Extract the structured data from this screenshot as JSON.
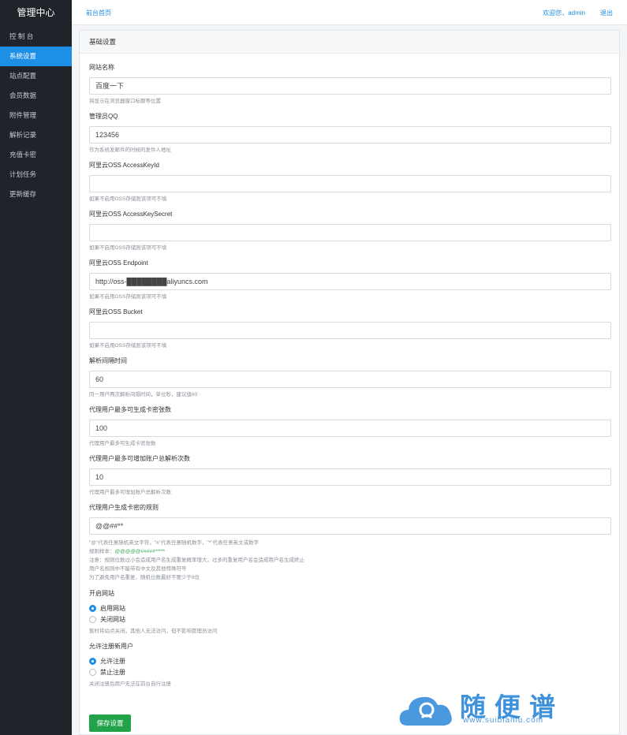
{
  "sidebar": {
    "brand": "管理中心",
    "items": [
      {
        "label": "控 制 台"
      },
      {
        "label": "系统设置"
      },
      {
        "label": "站点配置"
      },
      {
        "label": "会员数据"
      },
      {
        "label": "附件管理"
      },
      {
        "label": "解析记录"
      },
      {
        "label": "充值卡密"
      },
      {
        "label": "计划任务"
      },
      {
        "label": "更新缓存"
      }
    ],
    "active_index": 1
  },
  "topbar": {
    "home": "前台首页",
    "welcome": "欢迎您，admin",
    "logout": "退出"
  },
  "panel": {
    "title": "基础设置"
  },
  "form": {
    "site_name": {
      "label": "网站名称",
      "value": "百度一下",
      "help": "将显示在浏览器窗口标题等位置"
    },
    "admin_qq": {
      "label": "管理员QQ",
      "value": "123456",
      "help": "作为系统发邮件的时候的发件人地址"
    },
    "oss_key_id": {
      "label": "阿里云OSS AccessKeyId",
      "value": "",
      "help": "如果不启用OSS存储则该项可不填"
    },
    "oss_key_secret": {
      "label": "阿里云OSS AccessKeySecret",
      "value": "",
      "help": "如果不启用OSS存储则该项可不填"
    },
    "oss_endpoint": {
      "label": "阿里云OSS Endpoint",
      "value": "http://oss-████████aliyuncs.com",
      "help": "如果不启用OSS存储则该项可不填"
    },
    "oss_bucket": {
      "label": "阿里云OSS Bucket",
      "value": "",
      "help": "如果不启用OSS存储则该项可不填"
    },
    "parse_interval": {
      "label": "解析间隔时间",
      "value": "60",
      "help": "同一用户两次解析间隔时间，单位秒，建议值60"
    },
    "agent_max_cards": {
      "label": "代理用户最多可生成卡密张数",
      "value": "100",
      "help": "代理用户最多可生成卡密张数"
    },
    "agent_max_parse": {
      "label": "代理用户最多可增加账户总解析次数",
      "value": "10",
      "help": "代理用户最多可增加账户总解析次数"
    },
    "card_rule": {
      "label": "代理用户生成卡密的规则",
      "value": "@@##**",
      "help1": "\"@\"代表任意随机英文字符，\"#\"代表任意随机数字，\"*\"代表任意英文或数字",
      "help2_prefix": "规则样本：",
      "help2_sample": "@@@@@#####*****",
      "help3": "注意：规则位数过小会造成用户名生成重复概率增大，过多的重复用户名会造成用户名生成终止",
      "help4": "用户名规则中不能带有中文及其他特殊符号",
      "help5": "为了避免用户名重复，随机位数最好不要少于8位"
    },
    "site_open": {
      "label": "开启网站",
      "option_on": "启用网站",
      "option_off": "关闭网站",
      "selected": "on",
      "help": "暂时将站点关闭，其他人无法访问，但不影响管理员访问"
    },
    "allow_register": {
      "label": "允许注册新用户",
      "option_on": "允许注册",
      "option_off": "禁止注册",
      "selected": "on",
      "help": "关闭注册后用户无法在前台自行注册"
    },
    "save_label": "保存设置"
  },
  "watermark": {
    "text": "随便谱",
    "url": "www.suibianlu.com"
  },
  "colors": {
    "sidebar_bg": "#1f242b",
    "accent": "#1e8fe6",
    "save_button": "#22a34a"
  }
}
